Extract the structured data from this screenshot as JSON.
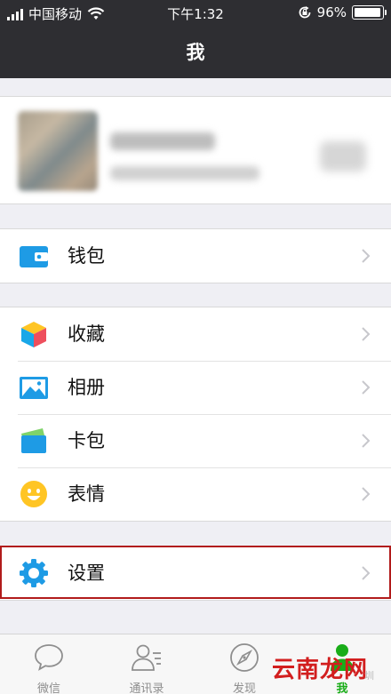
{
  "status_bar": {
    "carrier": "中国移动",
    "time": "下午1:32",
    "battery_text": "96%",
    "battery_level": 0.96
  },
  "nav": {
    "title": "我"
  },
  "menu": {
    "wallet": {
      "label": "钱包",
      "icon": "wallet-icon"
    },
    "favorites": {
      "label": "收藏",
      "icon": "cube-icon"
    },
    "album": {
      "label": "相册",
      "icon": "photo-icon"
    },
    "cards": {
      "label": "卡包",
      "icon": "card-icon"
    },
    "stickers": {
      "label": "表情",
      "icon": "smiley-icon"
    },
    "settings": {
      "label": "设置",
      "icon": "gear-icon"
    }
  },
  "tabbar": {
    "chats": "微信",
    "contacts": "通讯录",
    "discover": "发现",
    "me": "我"
  },
  "watermark": {
    "text": "云南龙网",
    "small": "圳"
  },
  "colors": {
    "nav_bg": "#2e2e32",
    "accent_green": "#1aad19",
    "icon_blue": "#1e9be5",
    "highlight_red": "#b11b1b"
  }
}
